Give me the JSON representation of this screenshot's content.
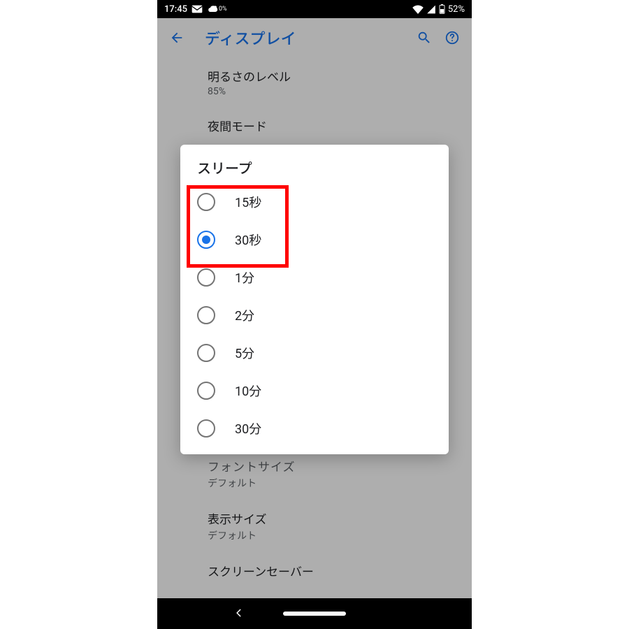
{
  "statusbar": {
    "time": "17:45",
    "weather_pct": "0%",
    "battery": "52%"
  },
  "appbar": {
    "title": "ディスプレイ"
  },
  "settings": {
    "brightness_title": "明るさのレベル",
    "brightness_value": "85%",
    "night_title": "夜間モード",
    "fontsize_title": "フォントサイズ",
    "fontsize_value": "デフォルト",
    "dispsize_title": "表示サイズ",
    "dispsize_value": "デフォルト",
    "screensaver_title": "スクリーンセーバー"
  },
  "dialog": {
    "title": "スリープ",
    "options": [
      {
        "label": "15秒",
        "selected": false
      },
      {
        "label": "30秒",
        "selected": true
      },
      {
        "label": "1分",
        "selected": false
      },
      {
        "label": "2分",
        "selected": false
      },
      {
        "label": "5分",
        "selected": false
      },
      {
        "label": "10分",
        "selected": false
      },
      {
        "label": "30分",
        "selected": false
      }
    ]
  }
}
